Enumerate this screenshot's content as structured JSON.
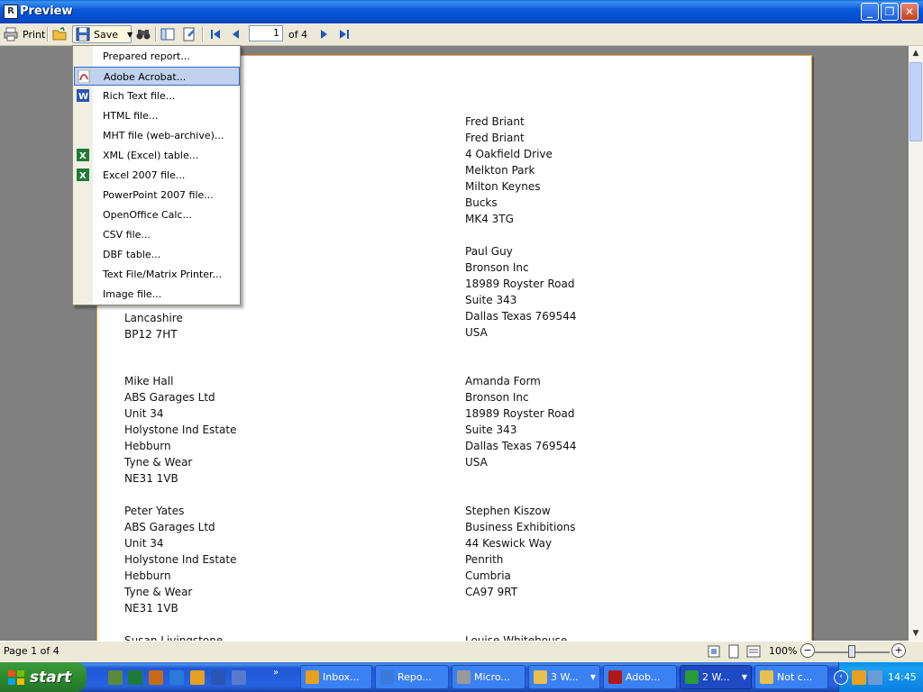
{
  "window": {
    "title": "Preview"
  },
  "toolbar": {
    "print_label": "Print",
    "save_label": "Save",
    "page_value": "1",
    "page_of": "of 4"
  },
  "save_menu": {
    "items": [
      {
        "label": "Prepared report...",
        "icon": null
      },
      {
        "label": "Adobe Acrobat...",
        "icon": "pdf-icon",
        "highlighted": true
      },
      {
        "label": "Rich Text file...",
        "icon": "word-icon"
      },
      {
        "label": "HTML file...",
        "icon": null
      },
      {
        "label": "MHT file (web-archive)...",
        "icon": null
      },
      {
        "label": "XML (Excel) table...",
        "icon": "excel-icon"
      },
      {
        "label": "Excel 2007 file...",
        "icon": "excel-icon"
      },
      {
        "label": "PowerPoint 2007 file...",
        "icon": null
      },
      {
        "label": "OpenOffice Calc...",
        "icon": null
      },
      {
        "label": "CSV file...",
        "icon": null
      },
      {
        "label": "DBF table...",
        "icon": null
      },
      {
        "label": "Text File/Matrix Printer...",
        "icon": null
      },
      {
        "label": "Image file...",
        "icon": null
      }
    ]
  },
  "document": {
    "left_column": [
      {
        "lines": [
          "Lancashire",
          "BP12 7HT"
        ]
      },
      {
        "lines": [
          "Mike Hall",
          "ABS Garages Ltd",
          "Unit 34",
          "Holystone Ind Estate",
          "Hebburn",
          "Tyne & Wear",
          "NE31 1VB"
        ]
      },
      {
        "lines": [
          "Peter Yates",
          "ABS Garages Ltd",
          "Unit 34",
          "Holystone Ind Estate",
          "Hebburn",
          "Tyne & Wear",
          "NE31 1VB"
        ]
      },
      {
        "lines": [
          "Susan Livingstone"
        ]
      }
    ],
    "right_column": [
      {
        "lines": [
          "Fred Briant",
          "Fred Briant",
          "4 Oakfield Drive",
          "Melkton Park",
          "Milton Keynes",
          "Bucks",
          "MK4 3TG"
        ]
      },
      {
        "lines": [
          "Paul Guy",
          "Bronson Inc",
          "18989 Royster Road",
          "Suite 343",
          "Dallas Texas 769544",
          "USA"
        ]
      },
      {
        "lines": [
          "Amanda Form",
          "Bronson Inc",
          "18989 Royster Road",
          "Suite 343",
          "Dallas Texas 769544",
          "USA"
        ]
      },
      {
        "lines": [
          "Stephen Kiszow",
          "Business Exhibitions",
          "44 Keswick Way",
          "Penrith",
          "Cumbria",
          "CA97 9RT"
        ]
      },
      {
        "lines": [
          "Louise Whitehouse"
        ]
      }
    ]
  },
  "statusbar": {
    "page_text": "Page 1 of 4",
    "zoom": "100%",
    "zoom_minus": "−",
    "zoom_plus": "+"
  },
  "taskbar": {
    "start_label": "start",
    "tasks": [
      {
        "label": "Inbox...",
        "icon_color": "#e8a020"
      },
      {
        "label": "Repo...",
        "icon_color": "#3a7ad8"
      },
      {
        "label": "Micro...",
        "icon_color": "#999"
      },
      {
        "label": "3 W...",
        "icon_color": "#e8c050",
        "dropdown": true
      },
      {
        "label": "Adob...",
        "icon_color": "#b01818"
      },
      {
        "label": "2 W...",
        "icon_color": "#2a9a3a",
        "dropdown": true,
        "active": true
      },
      {
        "label": "Not c...",
        "icon_color": "#e8c050"
      }
    ],
    "clock": "14:45"
  },
  "colors": {
    "titlebar": "#0a59d8",
    "menu_highlight": "#c1d2ee",
    "page_border": "#f0a030"
  }
}
